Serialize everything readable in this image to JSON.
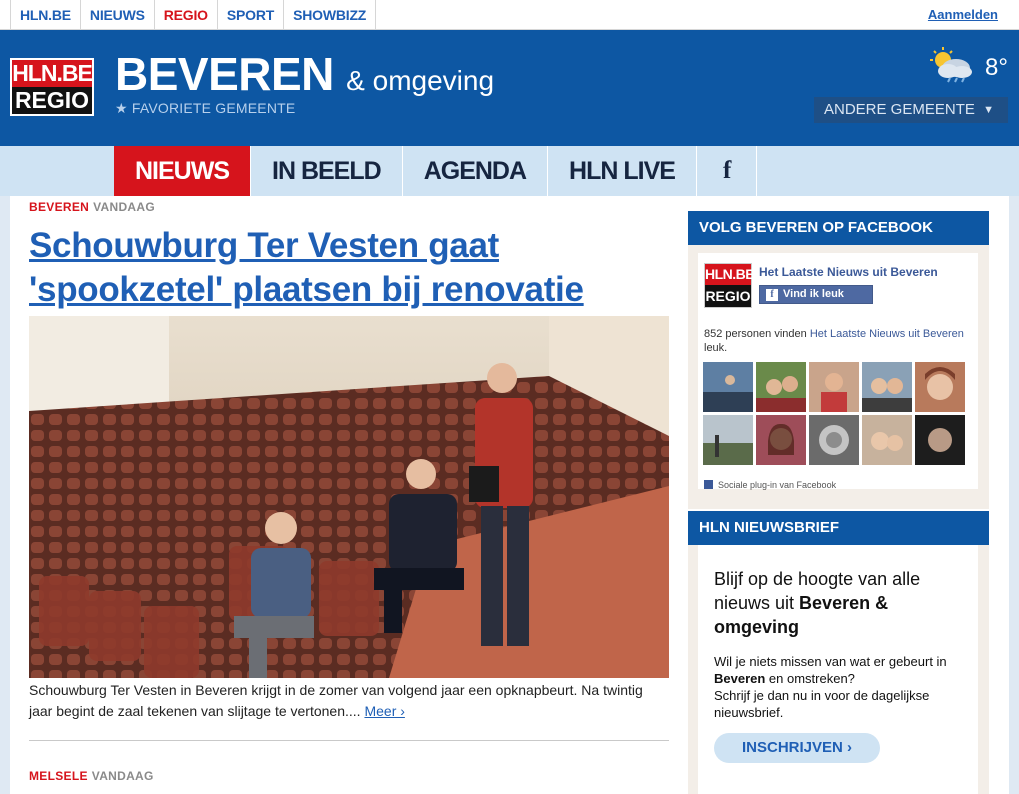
{
  "topnav": {
    "items": [
      "HLN.BE",
      "NIEUWS",
      "REGIO",
      "SPORT",
      "SHOWBIZZ"
    ],
    "active_index": 2,
    "login": "Aanmelden"
  },
  "header": {
    "logo_top": "HLN.BE",
    "logo_bottom": "REGIO",
    "city": "BEVEREN",
    "city_suffix": "& omgeving",
    "favorite": "★ FAVORIETE GEMEENTE",
    "weather_icon": "partly-cloudy-rain-icon",
    "temperature": "8°",
    "other_municipality": "ANDERE GEMEENTE",
    "other_caret": "▼"
  },
  "section_nav": {
    "tabs": [
      "NIEUWS",
      "IN BEELD",
      "AGENDA",
      "HLN LIVE",
      "f"
    ],
    "active_index": 0
  },
  "article": {
    "place": "BEVEREN",
    "when": "VANDAAG",
    "headline": "Schouwburg Ter Vesten gaat 'spookzetel' plaatsen bij renovatie",
    "caption": "Schouwburg Ter Vesten in Beveren krijgt in de zomer van volgend jaar een opknapbeurt. Na twintig jaar begint de zaal tekenen van slijtage te vertonen....",
    "more": "Meer ›"
  },
  "next_article": {
    "place": "MELSELE",
    "when": "VANDAAG"
  },
  "facebook_box": {
    "title": "VOLG BEVEREN OP FACEBOOK",
    "logo_top": "HLN.BE",
    "logo_bottom": "REGIO",
    "page_name": "Het Laatste Nieuws uit Beveren",
    "like_label": "Vind ik leuk",
    "like_icon": "f",
    "count_text": "852 personen vinden ",
    "count_page": "Het Laatste Nieuws uit Beveren",
    "count_suffix": " leuk.",
    "footer": "Sociale plug-in van Facebook"
  },
  "newsletter_box": {
    "title": "HLN NIEUWSBRIEF",
    "lead_1": "Blijf op de hoogte van alle nieuws uit ",
    "lead_bold": "Beveren & omgeving",
    "body_1": "Wil je niets missen van wat er gebeurt in ",
    "body_bold": "Beveren",
    "body_2": " en omstreken?",
    "body_3": "Schrijf je dan nu in voor de dagelijkse nieuwsbrief.",
    "button": "INSCHRIJVEN ›"
  },
  "colors": {
    "brand_blue": "#0d57a3",
    "brand_red": "#d6141c",
    "link_blue": "#1f5fb5",
    "nav_light": "#cfe3f3"
  }
}
